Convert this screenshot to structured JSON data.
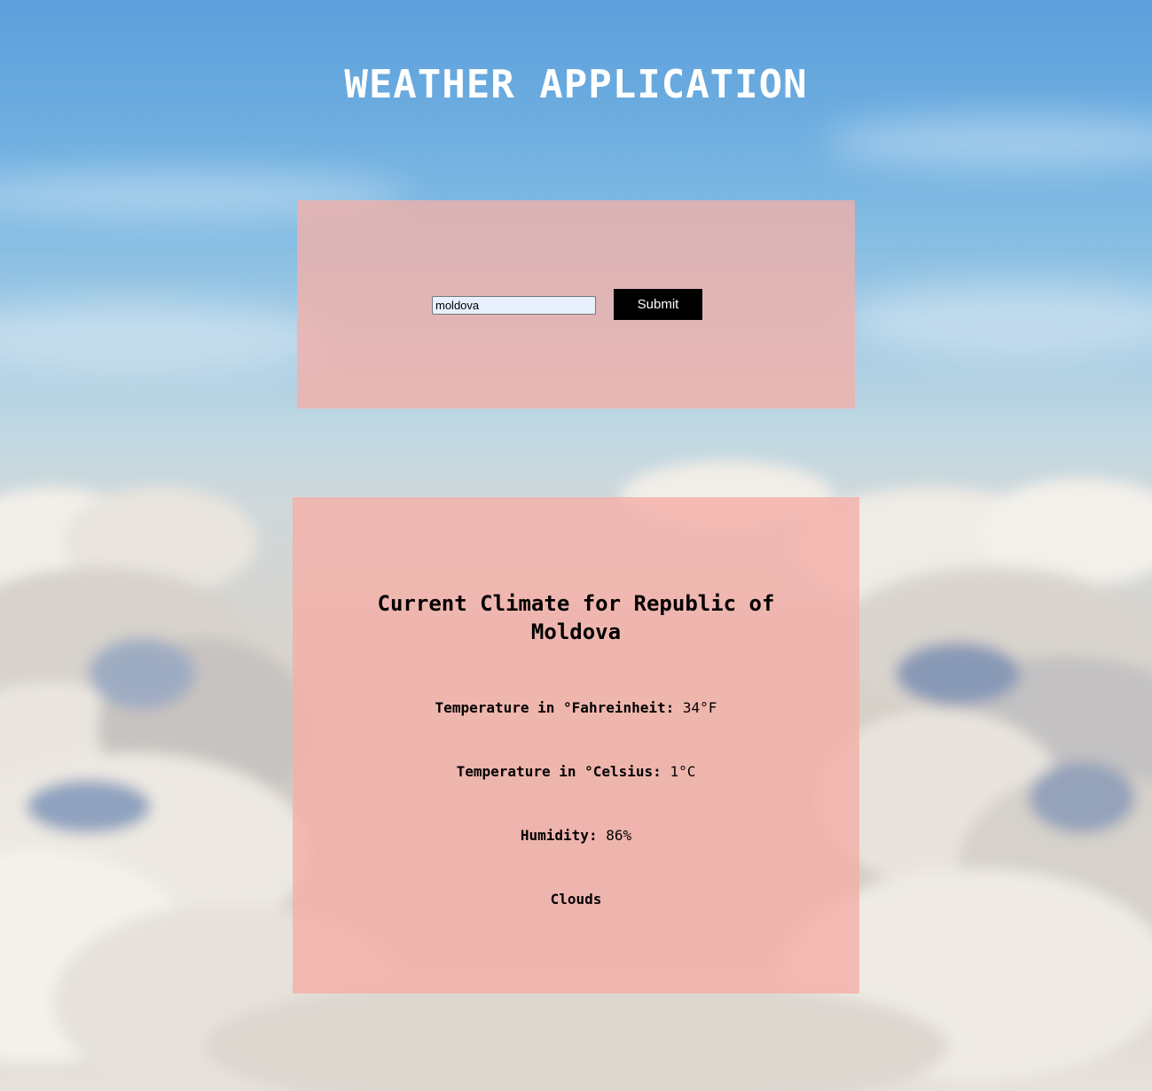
{
  "header": {
    "title": "WEATHER APPLICATION"
  },
  "search": {
    "value": "moldova",
    "submit_label": "Submit"
  },
  "result": {
    "heading": "Current Climate for Republic of Moldova",
    "fahrenheit_label": "Temperature in °Fahreinheit:",
    "fahrenheit_value": "34°F",
    "celsius_label": "Temperature in °Celsius:",
    "celsius_value": "1°C",
    "humidity_label": "Humidity:",
    "humidity_value": "86%",
    "description": "Clouds"
  },
  "colors": {
    "sky_top": "#5c9fdc",
    "panel": "#f4b0a8",
    "button": "#000000",
    "title_text": "#ffffff"
  }
}
